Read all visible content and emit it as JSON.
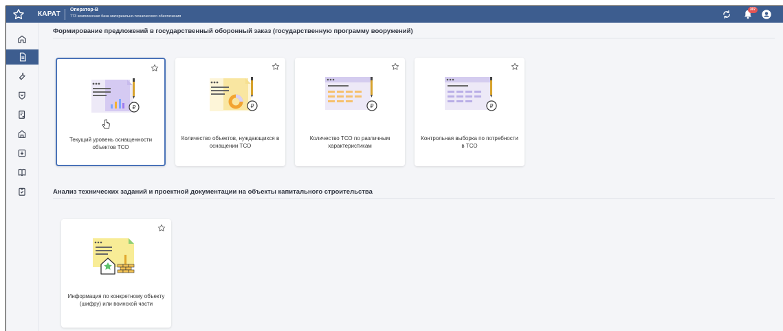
{
  "header": {
    "app_title": "КАРАТ",
    "operator": "Оператор-В",
    "organization": "773 комплексная база материально-технического обеспечения",
    "notification_badge": "307"
  },
  "sidebar": {
    "items": [
      {
        "icon": "home-icon",
        "active": false
      },
      {
        "icon": "document-icon",
        "active": true
      },
      {
        "icon": "wrench-icon",
        "active": false
      },
      {
        "icon": "shield-icon",
        "active": false
      },
      {
        "icon": "report-icon",
        "active": false
      },
      {
        "icon": "building-icon",
        "active": false
      },
      {
        "icon": "download-icon",
        "active": false
      },
      {
        "icon": "book-icon",
        "active": false
      },
      {
        "icon": "clipboard-check-icon",
        "active": false
      }
    ]
  },
  "sections": [
    {
      "title": "Формирование предложений в государственный оборонный заказ (государственную программу вооружений)",
      "cards": [
        {
          "label": "Текущий уровень оснащенности объектов ТСО",
          "icon": "bar-chart-document-icon",
          "selected": true
        },
        {
          "label": "Количество объектов, нуждающихся в оснащении ТСО",
          "icon": "donut-chart-document-icon",
          "selected": false
        },
        {
          "label": "Количество ТСО по различным характеристикам",
          "icon": "table-document-orange-icon",
          "selected": false
        },
        {
          "label": "Контрольная выборка по потребности в ТСО",
          "icon": "table-document-purple-icon",
          "selected": false
        }
      ]
    },
    {
      "title": "Анализ технических заданий и проектной документации на объекты капитального строительства",
      "cards": [
        {
          "label": "Информация по конкретному объекту (шифру) или воинской части",
          "icon": "building-document-icon",
          "selected": false
        }
      ]
    }
  ]
}
